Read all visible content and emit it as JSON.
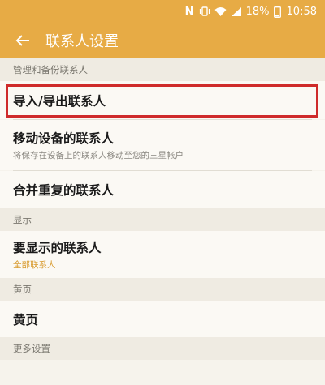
{
  "status_bar": {
    "nfc": "N",
    "battery_pct": "18%",
    "time": "10:58"
  },
  "header": {
    "title": "联系人设置"
  },
  "sections": {
    "manage": {
      "header": "管理和备份联系人",
      "import_export": {
        "title": "导入/导出联系人"
      },
      "move": {
        "title": "移动设备的联系人",
        "subtitle": "将保存在设备上的联系人移动至您的三星帐户"
      },
      "merge": {
        "title": "合并重复的联系人"
      }
    },
    "display": {
      "header": "显示",
      "contacts_to_display": {
        "title": "要显示的联系人",
        "value": "全部联系人"
      }
    },
    "yellow_pages": {
      "header": "黄页",
      "item": {
        "title": "黄页"
      }
    },
    "more": {
      "header": "更多设置"
    }
  },
  "colors": {
    "accent": "#e7ab45",
    "highlight": "#cf2b2b",
    "value_text": "#d89a2c"
  },
  "icons": [
    "nfc-icon",
    "vibrate-icon",
    "wifi-icon",
    "signal-icon",
    "battery-icon",
    "back-arrow-icon"
  ]
}
